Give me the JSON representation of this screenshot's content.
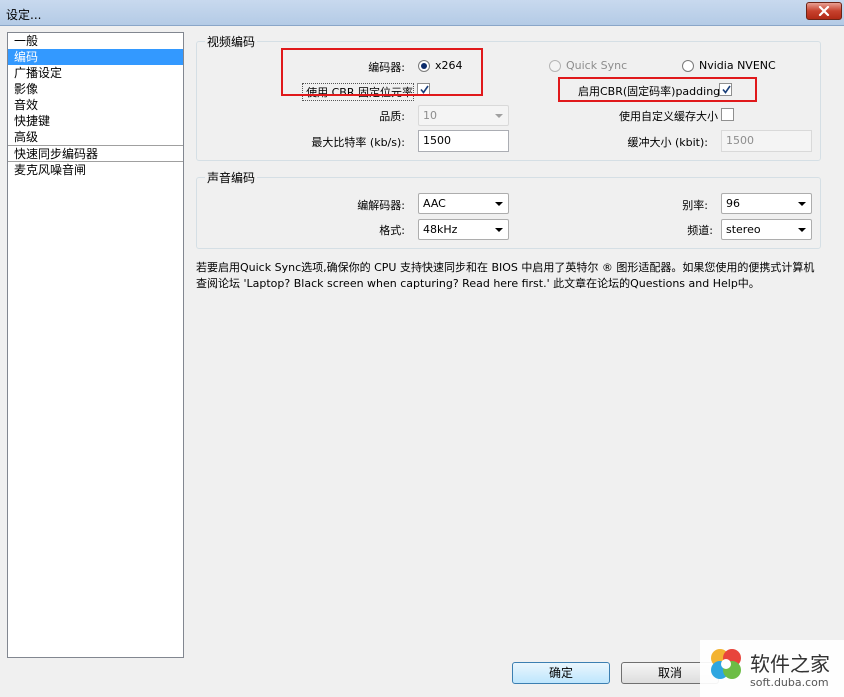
{
  "window": {
    "title": "设定..."
  },
  "sidebar": {
    "items": [
      {
        "label": "一般"
      },
      {
        "label": "编码"
      },
      {
        "label": "广播设定"
      },
      {
        "label": "影像"
      },
      {
        "label": "音效"
      },
      {
        "label": "快捷键"
      },
      {
        "label": "高级"
      },
      {
        "label": "快速同步编码器"
      },
      {
        "label": "麦克风噪音闸"
      }
    ],
    "selected": "编码"
  },
  "video": {
    "group_label": "视频编码",
    "encoder_label": "编码器:",
    "encoders": [
      {
        "label": "x264",
        "checked": true,
        "enabled": true
      },
      {
        "label": "Quick Sync",
        "checked": false,
        "enabled": false
      },
      {
        "label": "Nvidia NVENC",
        "checked": false,
        "enabled": true
      }
    ],
    "cbr_label": "使用 CBR 固定位元率",
    "cbr_checked": true,
    "cbr_padding_label": "启用CBR(固定码率)padding",
    "cbr_padding_checked": true,
    "quality_label": "品质:",
    "quality_value": "10",
    "custom_buffer_label": "使用自定义缓存大小",
    "custom_buffer_checked": false,
    "max_bitrate_label": "最大比特率 (kb/s):",
    "max_bitrate_value": "1500",
    "buffer_size_label": "缓冲大小 (kbit):",
    "buffer_size_value": "1500"
  },
  "audio": {
    "group_label": "声音编码",
    "codec_label": "编解码器:",
    "codec_value": "AAC",
    "bitrate_label": "别率:",
    "bitrate_value": "96",
    "format_label": "格式:",
    "format_value": "48kHz",
    "channel_label": "频道:",
    "channel_value": "stereo"
  },
  "info_text": "若要启用Quick Sync选项,确保你的 CPU 支持快速同步和在 BIOS 中启用了英特尔 ® 图形适配器。如果您使用的便携式计算机查阅论坛 'Laptop? Black screen when capturing? Read here first.' 此文章在论坛的Questions and Help中。",
  "buttons": {
    "ok": "确定",
    "cancel": "取消"
  },
  "watermark": {
    "name": "软件之家",
    "url": "soft.duba.com"
  }
}
